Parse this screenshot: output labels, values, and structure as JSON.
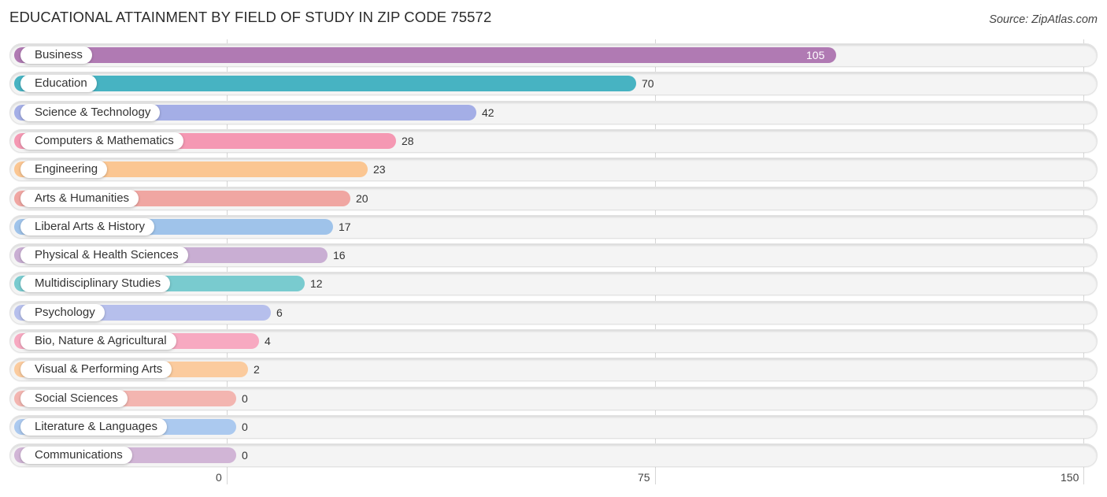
{
  "header": {
    "title": "EDUCATIONAL ATTAINMENT BY FIELD OF STUDY IN ZIP CODE 75572",
    "source": "Source: ZipAtlas.com"
  },
  "chart_data": {
    "type": "bar",
    "orientation": "horizontal",
    "title": "EDUCATIONAL ATTAINMENT BY FIELD OF STUDY IN ZIP CODE 75572",
    "xlabel": "",
    "ylabel": "",
    "xlim": [
      0,
      150
    ],
    "xticks": [
      0,
      75,
      150
    ],
    "xtick_labels": [
      "0",
      "75",
      "150"
    ],
    "grid": true,
    "categories": [
      "Business",
      "Education",
      "Science & Technology",
      "Computers & Mathematics",
      "Engineering",
      "Arts & Humanities",
      "Liberal Arts & History",
      "Physical & Health Sciences",
      "Multidisciplinary Studies",
      "Psychology",
      "Bio, Nature & Agricultural",
      "Visual & Performing Arts",
      "Social Sciences",
      "Literature & Languages",
      "Communications"
    ],
    "values": [
      105,
      70,
      42,
      28,
      23,
      20,
      17,
      16,
      12,
      6,
      4,
      2,
      0,
      0,
      0
    ],
    "value_labels": [
      "105",
      "70",
      "42",
      "28",
      "23",
      "20",
      "17",
      "16",
      "12",
      "6",
      "4",
      "2",
      "0",
      "0",
      "0"
    ],
    "colors": [
      "#b07ab3",
      "#47b3c2",
      "#a4aee6",
      "#f598b3",
      "#fbc692",
      "#f0a6a2",
      "#9fc3ea",
      "#c9aed3",
      "#79cbcf",
      "#b6bfec",
      "#f7a9c1",
      "#fbcb9e",
      "#f3b5b0",
      "#abc9ef",
      "#d1b5d6"
    ]
  }
}
